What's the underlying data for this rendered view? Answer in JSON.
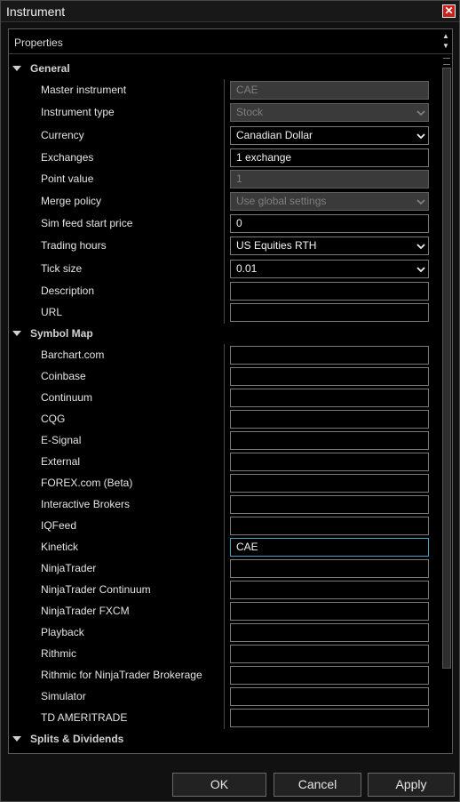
{
  "window": {
    "title": "Instrument"
  },
  "panel": {
    "header": "Properties"
  },
  "categories": {
    "general": "General",
    "symbol_map": "Symbol Map",
    "splits": "Splits & Dividends"
  },
  "general": [
    {
      "label": "Master instrument",
      "value": "CAE",
      "type": "text",
      "disabled": true
    },
    {
      "label": "Instrument type",
      "value": "Stock",
      "type": "select",
      "disabled": true
    },
    {
      "label": "Currency",
      "value": "Canadian Dollar",
      "type": "select",
      "disabled": false
    },
    {
      "label": "Exchanges",
      "value": "1 exchange",
      "type": "text",
      "disabled": false
    },
    {
      "label": "Point value",
      "value": "1",
      "type": "text",
      "disabled": true
    },
    {
      "label": "Merge policy",
      "value": "Use global settings",
      "type": "select",
      "disabled": true
    },
    {
      "label": "Sim feed start price",
      "value": "0",
      "type": "text",
      "disabled": false
    },
    {
      "label": "Trading hours",
      "value": "US Equities RTH",
      "type": "select",
      "disabled": false
    },
    {
      "label": "Tick size",
      "value": "0.01",
      "type": "select",
      "disabled": false
    },
    {
      "label": "Description",
      "value": "",
      "type": "text",
      "disabled": false
    },
    {
      "label": "URL",
      "value": "",
      "type": "text",
      "disabled": false
    }
  ],
  "symbol_map": [
    {
      "label": "Barchart.com",
      "value": ""
    },
    {
      "label": "Coinbase",
      "value": ""
    },
    {
      "label": "Continuum",
      "value": ""
    },
    {
      "label": "CQG",
      "value": ""
    },
    {
      "label": "E-Signal",
      "value": ""
    },
    {
      "label": "External",
      "value": ""
    },
    {
      "label": "FOREX.com (Beta)",
      "value": ""
    },
    {
      "label": "Interactive Brokers",
      "value": ""
    },
    {
      "label": "IQFeed",
      "value": ""
    },
    {
      "label": "Kinetick",
      "value": "CAE"
    },
    {
      "label": "NinjaTrader",
      "value": ""
    },
    {
      "label": "NinjaTrader Continuum",
      "value": ""
    },
    {
      "label": "NinjaTrader FXCM",
      "value": ""
    },
    {
      "label": "Playback",
      "value": ""
    },
    {
      "label": "Rithmic",
      "value": ""
    },
    {
      "label": "Rithmic for NinjaTrader Brokerage",
      "value": ""
    },
    {
      "label": "Simulator",
      "value": ""
    },
    {
      "label": "TD AMERITRADE",
      "value": ""
    }
  ],
  "buttons": {
    "ok": "OK",
    "cancel": "Cancel",
    "apply": "Apply"
  },
  "icons": {
    "close": "close-icon",
    "expand": "triangle-down-icon",
    "dropdown": "chevron-down-icon"
  },
  "colors": {
    "close_bg": "#c9201a",
    "focus_border": "#48a0c8",
    "disabled_bg": "#3a3a3a"
  }
}
